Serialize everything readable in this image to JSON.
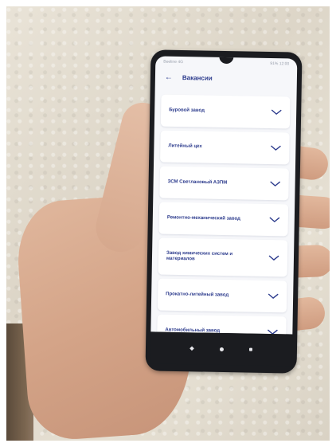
{
  "status_bar": {
    "left": "Beeline 4G",
    "right": "91% 12:00"
  },
  "app": {
    "title": "Вакансии",
    "back_icon": "arrow-left-icon"
  },
  "items": [
    {
      "label": "Буровой завод"
    },
    {
      "label": "Литейный цех"
    },
    {
      "label": "ЗСМ Светлановый АЗПМ"
    },
    {
      "label": "Ремонтно-механический завод"
    },
    {
      "label": "Завод химических систем и материалов"
    },
    {
      "label": "Прокатно-литейный завод"
    },
    {
      "label": "Автомобильный завод"
    }
  ],
  "nav_icons": [
    "back-nav-icon",
    "home-nav-icon",
    "recents-nav-icon"
  ]
}
